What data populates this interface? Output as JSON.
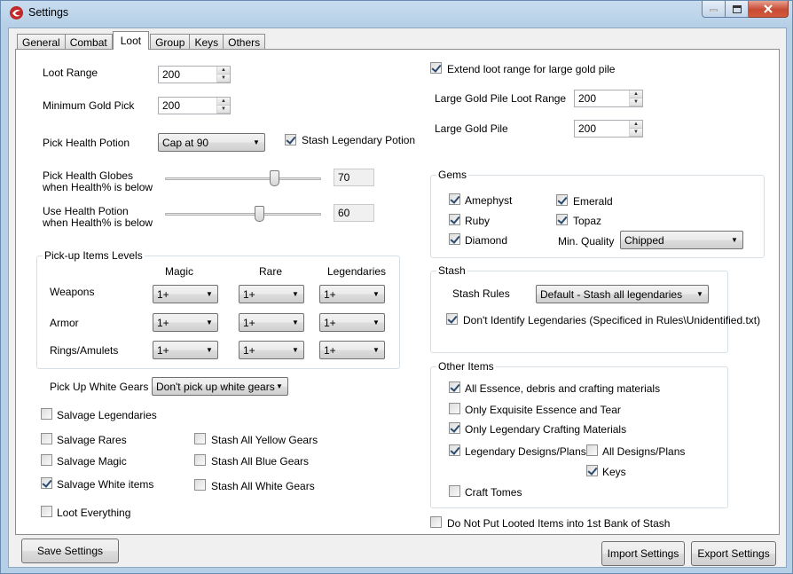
{
  "window": {
    "title": "Settings"
  },
  "tabs": [
    "General",
    "Combat",
    "Loot",
    "Group",
    "Keys",
    "Others"
  ],
  "active_tab": "Loot",
  "loot": {
    "loot_range": {
      "label": "Loot Range",
      "value": "200"
    },
    "min_gold": {
      "label": "Minimum Gold Pick",
      "value": "200"
    },
    "pick_health_potion": {
      "label": "Pick Health Potion",
      "value": "Cap at 90"
    },
    "stash_legendary_potion": {
      "label": "Stash Legendary Potion",
      "checked": true
    },
    "globes": {
      "label1": "Pick Health Globes",
      "label2": "when Health% is below",
      "value": "70",
      "level": 70
    },
    "use_potion": {
      "label1": "Use Health Potion",
      "label2": "when Health% is below",
      "value": "60",
      "level": 60
    },
    "items_levels": {
      "title": "Pick-up Items Levels",
      "columns": [
        "Magic",
        "Rare",
        "Legendaries"
      ],
      "rows": [
        {
          "label": "Weapons",
          "values": [
            "1+",
            "1+",
            "1+"
          ]
        },
        {
          "label": "Armor",
          "values": [
            "1+",
            "1+",
            "1+"
          ]
        },
        {
          "label": "Rings/Amulets",
          "values": [
            "1+",
            "1+",
            "1+"
          ]
        }
      ]
    },
    "white_gears": {
      "label": "Pick Up White Gears",
      "value": "Don't pick up white gears"
    },
    "salvage_legendaries": {
      "label": "Salvage Legendaries",
      "checked": false
    },
    "salvage_rares": {
      "label": "Salvage Rares",
      "checked": false
    },
    "salvage_magic": {
      "label": "Salvage Magic",
      "checked": false
    },
    "salvage_white": {
      "label": "Salvage White items",
      "checked": true
    },
    "stash_yellow": {
      "label": "Stash All Yellow Gears",
      "checked": false
    },
    "stash_blue": {
      "label": "Stash All Blue Gears",
      "checked": false
    },
    "stash_white": {
      "label": "Stash All White Gears",
      "checked": false
    },
    "loot_everything": {
      "label": "Loot Everything",
      "checked": false
    },
    "extend_range": {
      "label": "Extend loot range for large gold pile",
      "checked": true
    },
    "large_gold_range": {
      "label": "Large Gold Pile Loot Range",
      "value": "200"
    },
    "large_gold_pile": {
      "label": "Large Gold Pile",
      "value": "200"
    },
    "gems": {
      "title": "Gems",
      "amethyst": "Amephyst",
      "ruby": "Ruby",
      "diamond": "Diamond",
      "emerald": "Emerald",
      "topaz": "Topaz",
      "min_quality_label": "Min. Quality",
      "min_quality": "Chipped"
    },
    "stash": {
      "title": "Stash",
      "rules_label": "Stash Rules",
      "rules_value": "Default - Stash all legendaries",
      "dont_identify": "Don't Identify Legendaries (Specificed in Rules\\Unidentified.txt)"
    },
    "other_items": {
      "title": "Other Items",
      "essence": "All Essence, debris and crafting materials",
      "exquisite": "Only Exquisite Essence and Tear",
      "legendary_crafting": "Only Legendary Crafting Materials",
      "legendary_designs": "Legendary Designs/Plans",
      "all_designs": "All Designs/Plans",
      "keys": "Keys",
      "craft_tomes": "Craft Tomes"
    },
    "dont_put_bank": "Do Not Put Looted Items into 1st Bank of Stash"
  },
  "buttons": {
    "save": "Save Settings",
    "import": "Import Settings",
    "export": "Export Settings"
  }
}
